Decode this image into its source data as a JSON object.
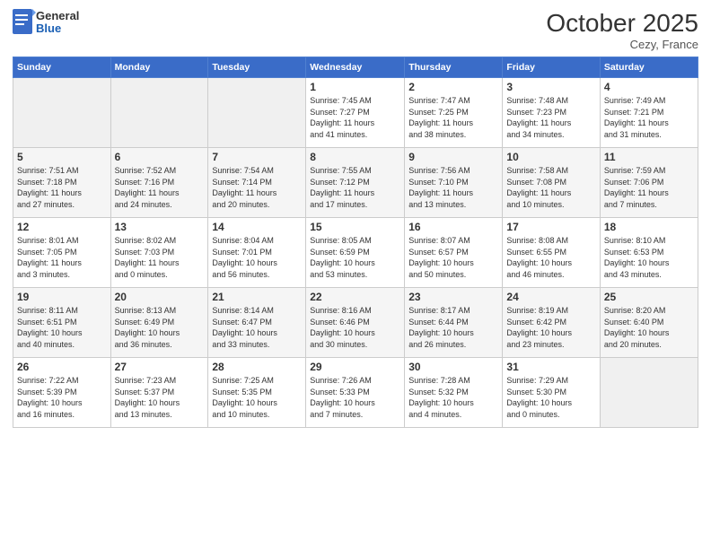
{
  "logo": {
    "general": "General",
    "blue": "Blue"
  },
  "header": {
    "month": "October 2025",
    "location": "Cezy, France"
  },
  "weekdays": [
    "Sunday",
    "Monday",
    "Tuesday",
    "Wednesday",
    "Thursday",
    "Friday",
    "Saturday"
  ],
  "weeks": [
    [
      {
        "day": "",
        "info": ""
      },
      {
        "day": "",
        "info": ""
      },
      {
        "day": "",
        "info": ""
      },
      {
        "day": "1",
        "info": "Sunrise: 7:45 AM\nSunset: 7:27 PM\nDaylight: 11 hours\nand 41 minutes."
      },
      {
        "day": "2",
        "info": "Sunrise: 7:47 AM\nSunset: 7:25 PM\nDaylight: 11 hours\nand 38 minutes."
      },
      {
        "day": "3",
        "info": "Sunrise: 7:48 AM\nSunset: 7:23 PM\nDaylight: 11 hours\nand 34 minutes."
      },
      {
        "day": "4",
        "info": "Sunrise: 7:49 AM\nSunset: 7:21 PM\nDaylight: 11 hours\nand 31 minutes."
      }
    ],
    [
      {
        "day": "5",
        "info": "Sunrise: 7:51 AM\nSunset: 7:18 PM\nDaylight: 11 hours\nand 27 minutes."
      },
      {
        "day": "6",
        "info": "Sunrise: 7:52 AM\nSunset: 7:16 PM\nDaylight: 11 hours\nand 24 minutes."
      },
      {
        "day": "7",
        "info": "Sunrise: 7:54 AM\nSunset: 7:14 PM\nDaylight: 11 hours\nand 20 minutes."
      },
      {
        "day": "8",
        "info": "Sunrise: 7:55 AM\nSunset: 7:12 PM\nDaylight: 11 hours\nand 17 minutes."
      },
      {
        "day": "9",
        "info": "Sunrise: 7:56 AM\nSunset: 7:10 PM\nDaylight: 11 hours\nand 13 minutes."
      },
      {
        "day": "10",
        "info": "Sunrise: 7:58 AM\nSunset: 7:08 PM\nDaylight: 11 hours\nand 10 minutes."
      },
      {
        "day": "11",
        "info": "Sunrise: 7:59 AM\nSunset: 7:06 PM\nDaylight: 11 hours\nand 7 minutes."
      }
    ],
    [
      {
        "day": "12",
        "info": "Sunrise: 8:01 AM\nSunset: 7:05 PM\nDaylight: 11 hours\nand 3 minutes."
      },
      {
        "day": "13",
        "info": "Sunrise: 8:02 AM\nSunset: 7:03 PM\nDaylight: 11 hours\nand 0 minutes."
      },
      {
        "day": "14",
        "info": "Sunrise: 8:04 AM\nSunset: 7:01 PM\nDaylight: 10 hours\nand 56 minutes."
      },
      {
        "day": "15",
        "info": "Sunrise: 8:05 AM\nSunset: 6:59 PM\nDaylight: 10 hours\nand 53 minutes."
      },
      {
        "day": "16",
        "info": "Sunrise: 8:07 AM\nSunset: 6:57 PM\nDaylight: 10 hours\nand 50 minutes."
      },
      {
        "day": "17",
        "info": "Sunrise: 8:08 AM\nSunset: 6:55 PM\nDaylight: 10 hours\nand 46 minutes."
      },
      {
        "day": "18",
        "info": "Sunrise: 8:10 AM\nSunset: 6:53 PM\nDaylight: 10 hours\nand 43 minutes."
      }
    ],
    [
      {
        "day": "19",
        "info": "Sunrise: 8:11 AM\nSunset: 6:51 PM\nDaylight: 10 hours\nand 40 minutes."
      },
      {
        "day": "20",
        "info": "Sunrise: 8:13 AM\nSunset: 6:49 PM\nDaylight: 10 hours\nand 36 minutes."
      },
      {
        "day": "21",
        "info": "Sunrise: 8:14 AM\nSunset: 6:47 PM\nDaylight: 10 hours\nand 33 minutes."
      },
      {
        "day": "22",
        "info": "Sunrise: 8:16 AM\nSunset: 6:46 PM\nDaylight: 10 hours\nand 30 minutes."
      },
      {
        "day": "23",
        "info": "Sunrise: 8:17 AM\nSunset: 6:44 PM\nDaylight: 10 hours\nand 26 minutes."
      },
      {
        "day": "24",
        "info": "Sunrise: 8:19 AM\nSunset: 6:42 PM\nDaylight: 10 hours\nand 23 minutes."
      },
      {
        "day": "25",
        "info": "Sunrise: 8:20 AM\nSunset: 6:40 PM\nDaylight: 10 hours\nand 20 minutes."
      }
    ],
    [
      {
        "day": "26",
        "info": "Sunrise: 7:22 AM\nSunset: 5:39 PM\nDaylight: 10 hours\nand 16 minutes."
      },
      {
        "day": "27",
        "info": "Sunrise: 7:23 AM\nSunset: 5:37 PM\nDaylight: 10 hours\nand 13 minutes."
      },
      {
        "day": "28",
        "info": "Sunrise: 7:25 AM\nSunset: 5:35 PM\nDaylight: 10 hours\nand 10 minutes."
      },
      {
        "day": "29",
        "info": "Sunrise: 7:26 AM\nSunset: 5:33 PM\nDaylight: 10 hours\nand 7 minutes."
      },
      {
        "day": "30",
        "info": "Sunrise: 7:28 AM\nSunset: 5:32 PM\nDaylight: 10 hours\nand 4 minutes."
      },
      {
        "day": "31",
        "info": "Sunrise: 7:29 AM\nSunset: 5:30 PM\nDaylight: 10 hours\nand 0 minutes."
      },
      {
        "day": "",
        "info": ""
      }
    ]
  ]
}
